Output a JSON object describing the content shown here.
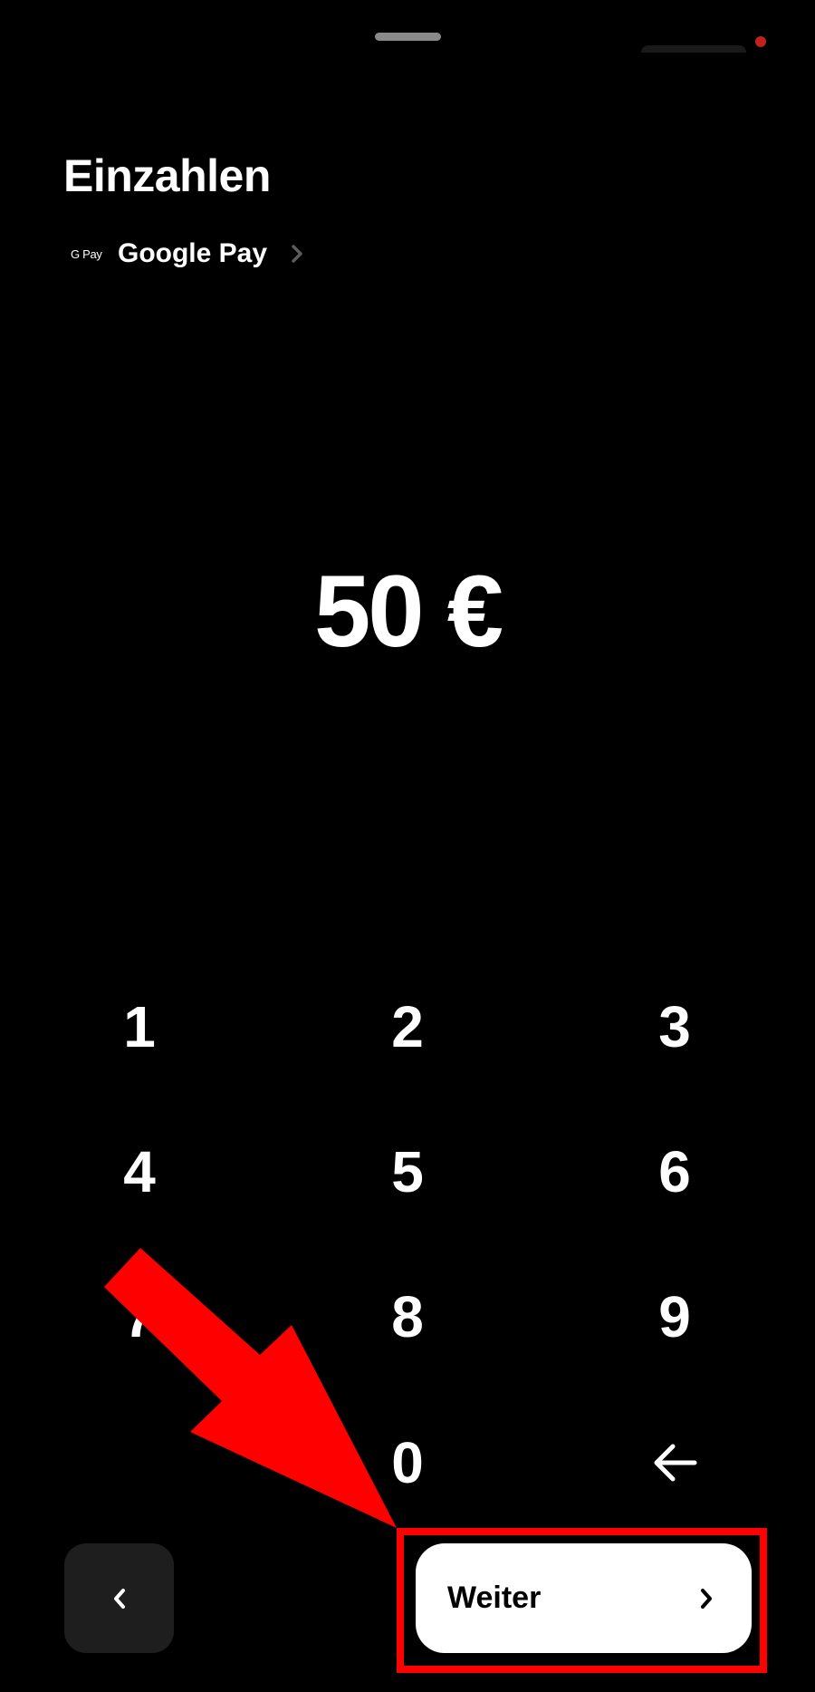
{
  "screen": {
    "title": "Einzahlen",
    "payment_method": {
      "logo_text": "G Pay",
      "label": "Google Pay",
      "icon": "chevron-right-icon"
    },
    "amount": "50 €"
  },
  "keypad": {
    "keys": [
      "1",
      "2",
      "3",
      "4",
      "5",
      "6",
      "7",
      "8",
      "9",
      "0"
    ],
    "backspace_icon": "arrow-left-icon"
  },
  "footer": {
    "back_icon": "chevron-left-icon",
    "next_label": "Weiter",
    "next_icon": "chevron-right-icon"
  },
  "annotation": {
    "color": "#ff0000",
    "icon": "red-pointer-arrow"
  }
}
